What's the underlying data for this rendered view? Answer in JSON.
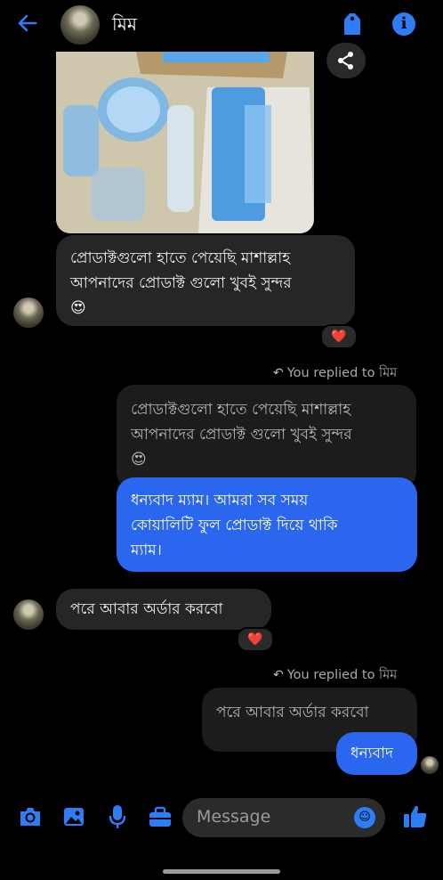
{
  "header": {
    "back_icon": "arrow-left-icon",
    "contact_name": "মিম",
    "tag_icon": "tag-icon",
    "info_icon": "info-icon"
  },
  "colors": {
    "accent": "#2d7df6",
    "outgoing_bubble": "#2b66ee",
    "incoming_bubble": "#262626",
    "background": "#000000",
    "heart": "#e5243b"
  },
  "messages": {
    "incoming_1": {
      "lines": [
        "প্রোডাক্টগুলো হাতে পেয়েছি মাশাল্লাহ",
        "আপনাদের প্রোডাক্ট গুলো খুবই সুন্দর"
      ],
      "emoji": "😍",
      "reaction": "❤️"
    },
    "reply_note_1": "You replied to মিম",
    "quoted_1": {
      "lines": [
        "প্রোডাক্টগুলো হাতে পেয়েছি মাশাল্লাহ",
        "আপনাদের প্রোডাক্ট গুলো খুবই সুন্দর"
      ],
      "emoji": "😍"
    },
    "outgoing_1": {
      "lines": [
        "ধন্যবাদ ম্যাম। আমরা সব সময়",
        "কোয়ালিটি ফুল প্রোডাক্ট দিয়ে থাকি",
        "ম্যাম।"
      ]
    },
    "incoming_2": {
      "text": "পরে আবার অর্ডার করবো",
      "reaction": "❤️"
    },
    "reply_note_2": "You replied to মিম",
    "quoted_2": {
      "text": "পরে আবার অর্ডার করবো"
    },
    "outgoing_2": {
      "text": "ধন্যবাদ"
    }
  },
  "composer": {
    "placeholder": "Message",
    "icons": [
      "camera-icon",
      "gallery-icon",
      "microphone-icon",
      "briefcase-icon",
      "emoji-icon",
      "thumbs-up-icon"
    ]
  }
}
